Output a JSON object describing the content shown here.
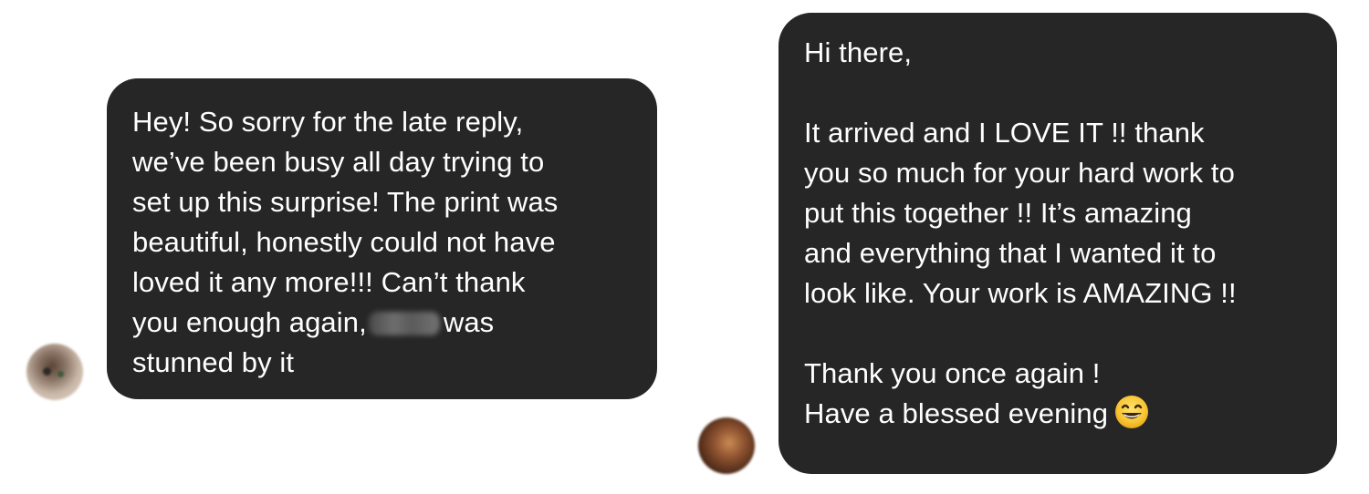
{
  "conversation": {
    "received": {
      "lines": [
        "Hey! So sorry for the late reply,",
        "we’ve been busy all day trying to",
        "set up this surprise! The print was",
        "beautiful, honestly could not have",
        "loved it any more!!! Can’t thank"
      ],
      "line6_before": "you enough again,",
      "line6_after": "was",
      "line7": "stunned by it"
    },
    "sent": {
      "greeting": "Hi there,",
      "body_lines": [
        "It arrived and I LOVE IT !! thank",
        "you so much for your hard work to",
        "put this together !! It’s amazing",
        "and everything that I wanted it to",
        "look like. Your work is AMAZING !!"
      ],
      "closing_line1": "Thank you once again !",
      "closing_line2": "Have a blessed evening",
      "emoji": "grinning-face-with-smiling-eyes"
    }
  },
  "colors": {
    "bubble_background": "#262626",
    "bubble_text": "#ffffff",
    "page_background": "#ffffff"
  }
}
